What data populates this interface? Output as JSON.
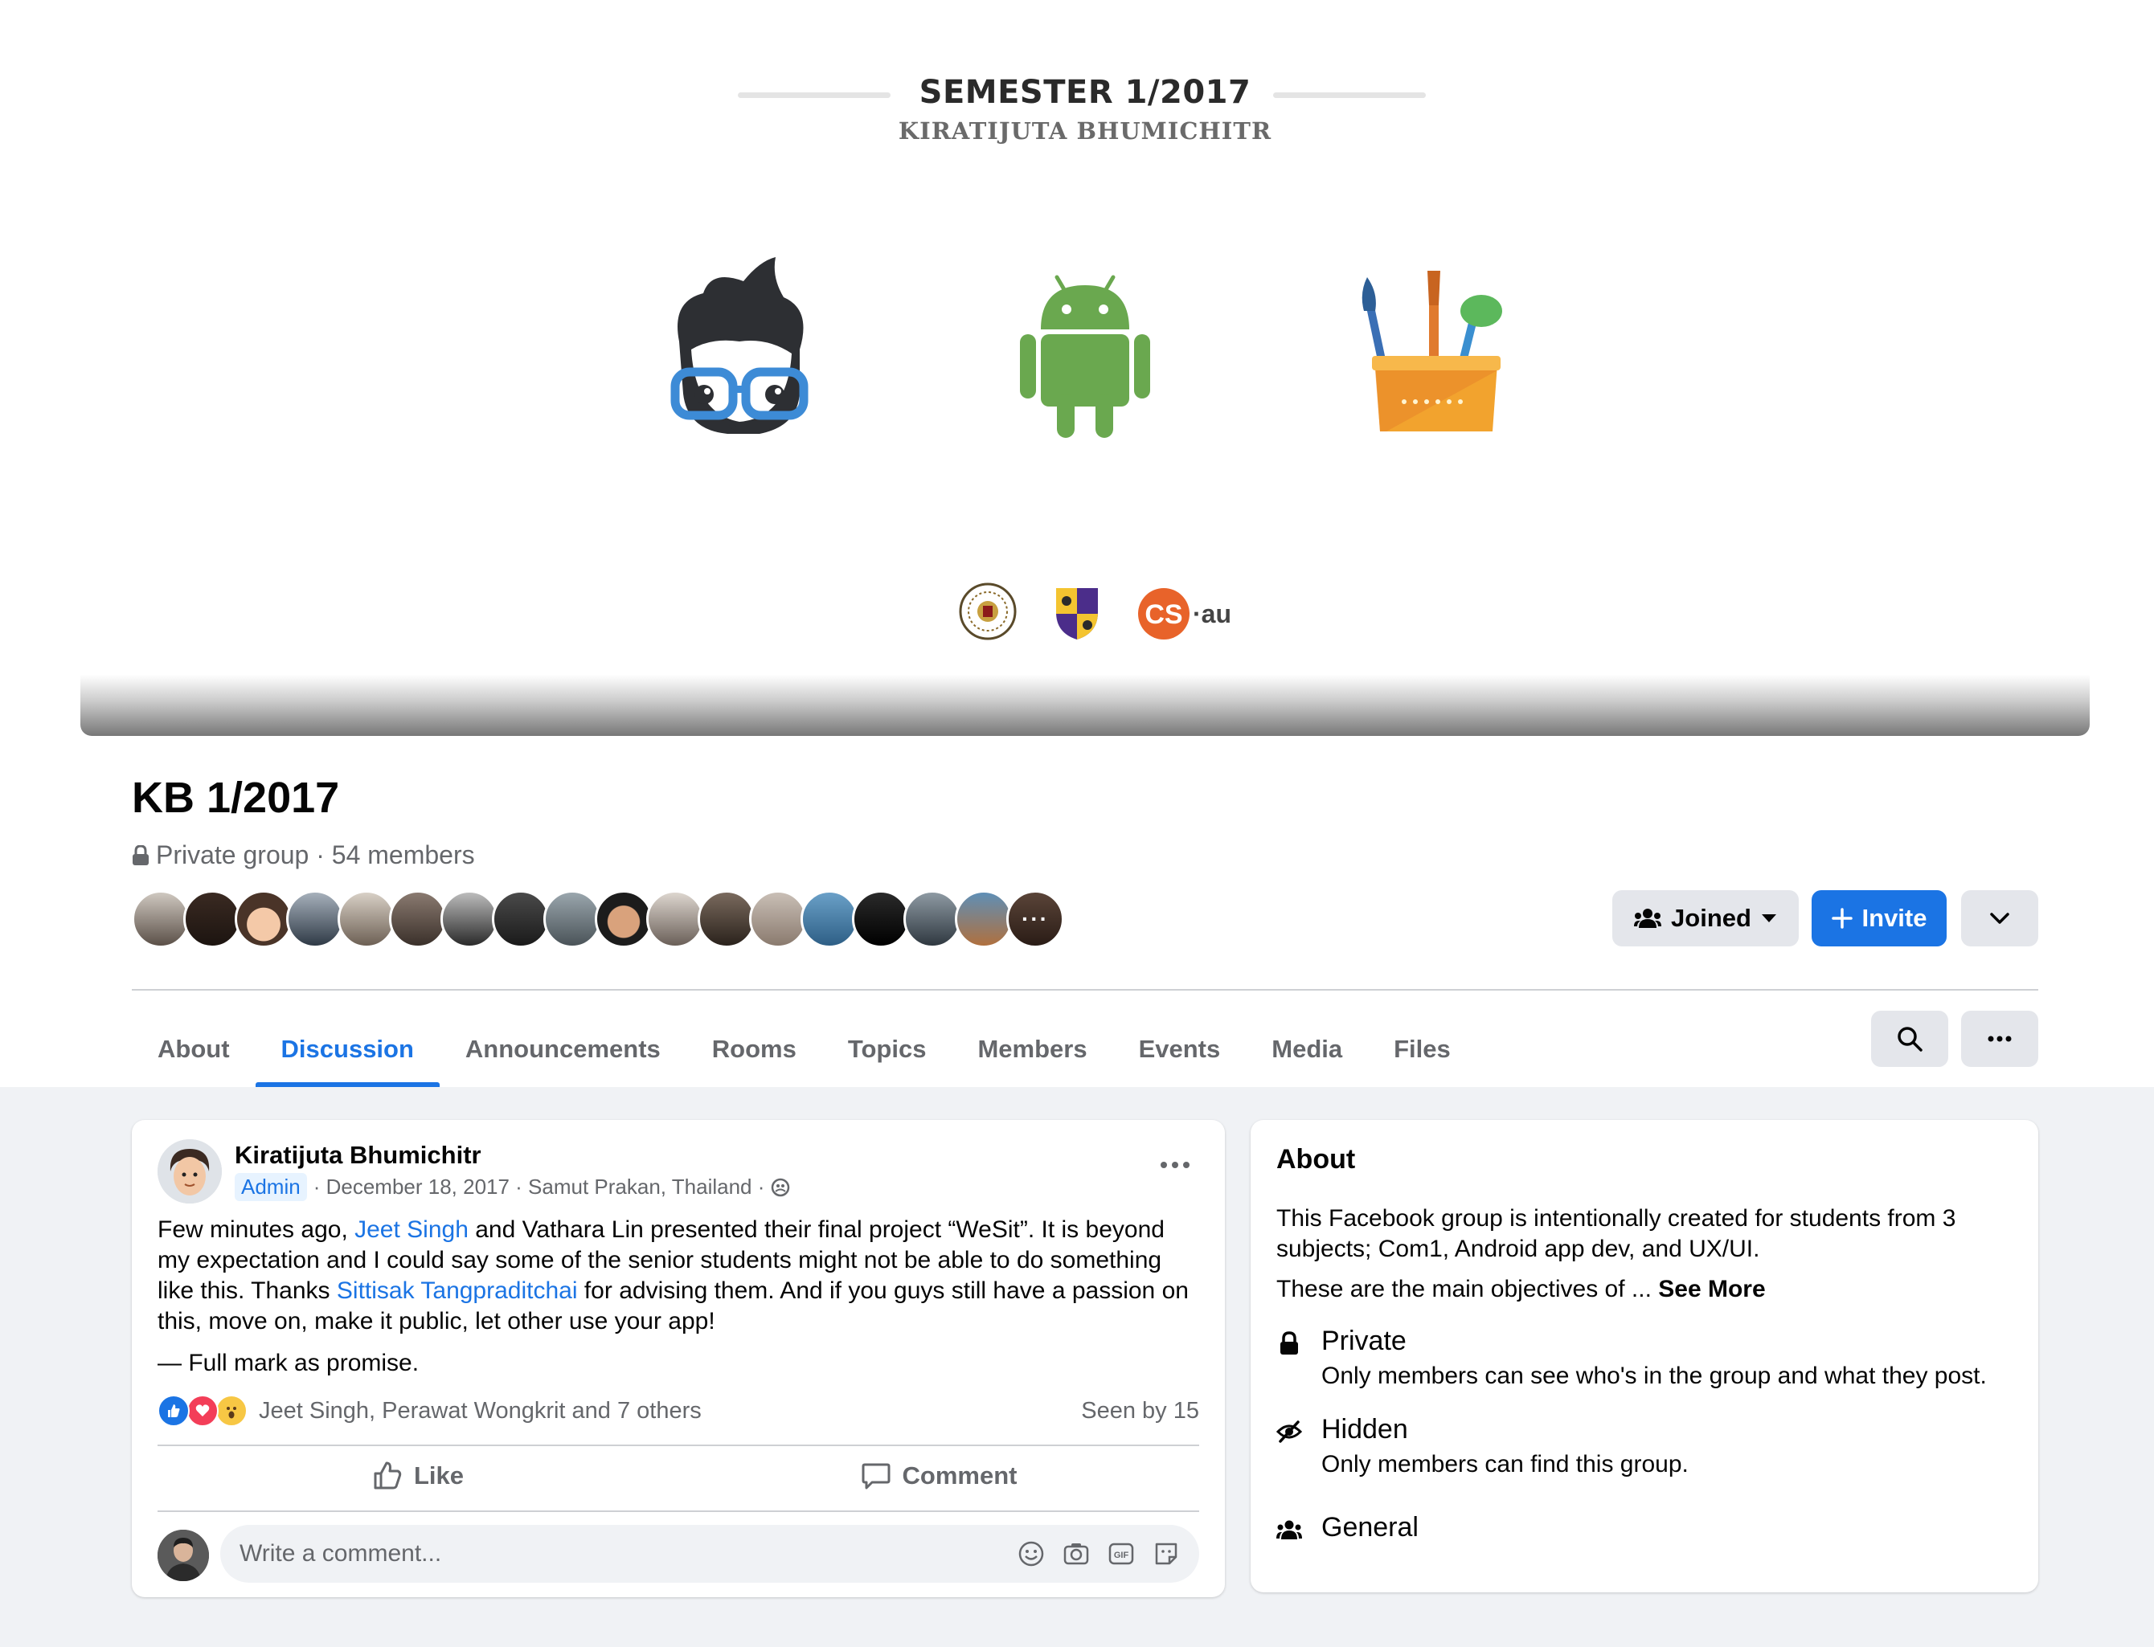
{
  "cover": {
    "title": "SEMESTER 1/2017",
    "subtitle": "KIRATIJUTA BHUMICHITR",
    "icons": [
      "nerd-face-icon",
      "android-icon",
      "paintbrush-cup-icon"
    ],
    "logos": [
      "university-seal-logo",
      "shield-crest-logo",
      "cs-au-logo"
    ],
    "cs_logo_text": "·au"
  },
  "group": {
    "name": "KB 1/2017",
    "meta": "Private group · 54 members",
    "more_members": "···"
  },
  "actions": {
    "joined_label": "Joined",
    "invite_label": "Invite",
    "accent": "#1b74e4"
  },
  "tabs": [
    {
      "label": "About"
    },
    {
      "label": "Discussion",
      "active": true
    },
    {
      "label": "Announcements"
    },
    {
      "label": "Rooms"
    },
    {
      "label": "Topics"
    },
    {
      "label": "Members"
    },
    {
      "label": "Events"
    },
    {
      "label": "Media"
    },
    {
      "label": "Files"
    }
  ],
  "post": {
    "author": "Kiratijuta Bhumichitr",
    "badge": "Admin",
    "meta": "· December 18, 2017 · Samut Prakan, Thailand ·",
    "body_parts": [
      "Few minutes ago, ",
      "Jeet Singh",
      " and Vathara Lin presented their final project “WeSit”. It is beyond my expectation and I could say some of the senior students might not be able to do something like this. Thanks ",
      "Sittisak Tangpraditchai",
      " for advising them. And if you guys still have a passion on this, move on, make it public, let other use your app!"
    ],
    "signature": "— Full mark as promise.",
    "reactions_names": "Jeet Singh, Perawat Wongkrit and 7 others",
    "seen": "Seen by 15",
    "like_label": "Like",
    "comment_label": "Comment",
    "comment_placeholder": "Write a comment..."
  },
  "about": {
    "title": "About",
    "description": "This Facebook group is intentionally created for students from 3 subjects; Com1, Android app dev, and UX/UI.",
    "more_text": "These are the main objectives of ... ",
    "see_more": "See More",
    "items": [
      {
        "icon": "lock-icon",
        "title": "Private",
        "text": "Only members can see who's in the group and what they post."
      },
      {
        "icon": "eye-hidden-icon",
        "title": "Hidden",
        "text": "Only members can find this group."
      },
      {
        "icon": "people-icon",
        "title": "General",
        "text": ""
      }
    ]
  }
}
